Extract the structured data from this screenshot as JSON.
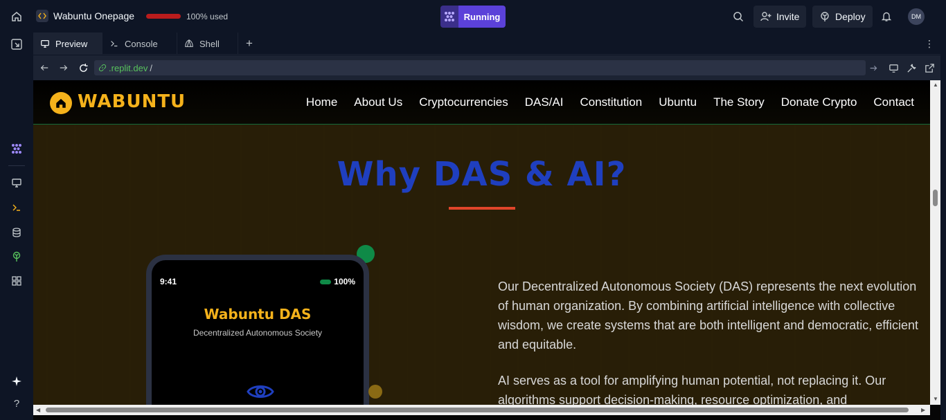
{
  "topbar": {
    "project_name": "Wabuntu Onepage",
    "usage_text": "100% used",
    "run_label": "Running",
    "invite_label": "Invite",
    "deploy_label": "Deploy",
    "avatar_initials": "DM"
  },
  "tabs": [
    {
      "label": "Preview",
      "icon": "monitor-icon",
      "active": true
    },
    {
      "label": "Console",
      "icon": "terminal-icon",
      "active": false
    },
    {
      "label": "Shell",
      "icon": "shell-icon",
      "active": false
    }
  ],
  "urlbar": {
    "host": ".replit.dev",
    "path": "/"
  },
  "site": {
    "logo_text": "WABUNTU",
    "nav": [
      "Home",
      "About Us",
      "Cryptocurrencies",
      "DAS/AI",
      "Constitution",
      "Ubuntu",
      "The Story",
      "Donate Crypto",
      "Contact"
    ],
    "section_title": "Why DAS & AI?",
    "phone": {
      "time": "9:41",
      "battery": "100%",
      "title": "Wabuntu DAS",
      "subtitle": "Decentralized Autonomous Society"
    },
    "paragraphs": [
      "Our Decentralized Autonomous Society (DAS) represents the next evolution of human organization. By combining artificial intelligence with collective wisdom, we create systems that are both intelligent and democratic, efficient and equitable.",
      "AI serves as a tool for amplifying human potential, not replacing it. Our algorithms support decision-making, resource optimization, and"
    ]
  },
  "colors": {
    "accent_gold": "#f5b21b",
    "title_blue": "#1f3fbf",
    "running_purple": "#5b41d9",
    "usage_red": "#b91c1c"
  }
}
